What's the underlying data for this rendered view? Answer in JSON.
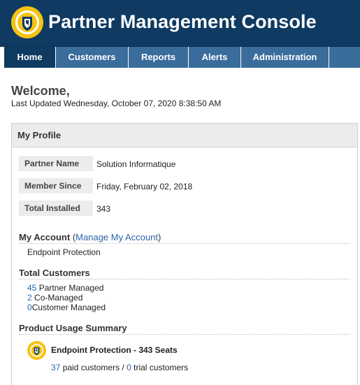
{
  "header": {
    "title": "Partner Management Console",
    "logo_icon": "shield-logo-icon",
    "brand_color": "#0f3a61",
    "accent_color": "#f6c313"
  },
  "nav": {
    "tabs": [
      {
        "label": "Home",
        "active": true
      },
      {
        "label": "Customers",
        "active": false
      },
      {
        "label": "Reports",
        "active": false
      },
      {
        "label": "Alerts",
        "active": false
      },
      {
        "label": "Administration",
        "active": false
      }
    ]
  },
  "welcome": {
    "heading": "Welcome,",
    "last_updated": "Last Updated Wednesday, October 07, 2020 8:38:50 AM"
  },
  "profile": {
    "title": "My Profile",
    "fields": [
      {
        "label": "Partner Name",
        "value": "Solution Informatique"
      },
      {
        "label": "Member Since",
        "value": "Friday, February 02, 2018"
      },
      {
        "label": "Total Installed",
        "value": "343"
      }
    ]
  },
  "account": {
    "title": "My Account",
    "open_paren": "(",
    "manage_link": "Manage My Account",
    "close_paren": ")",
    "product": "Endpoint Protection"
  },
  "customers": {
    "title": "Total Customers",
    "items": [
      {
        "count": "45",
        "label": "Partner Managed"
      },
      {
        "count": "2",
        "label": "Co-Managed"
      },
      {
        "count": "0",
        "label": "Customer Managed"
      }
    ]
  },
  "usage": {
    "title": "Product Usage Summary",
    "product_icon": "shield-product-icon",
    "product_name": "Endpoint Protection - 343 Seats",
    "paid_count": "37",
    "paid_label": "paid customers",
    "separator": "/",
    "trial_count": "0",
    "trial_label": "trial customers"
  }
}
